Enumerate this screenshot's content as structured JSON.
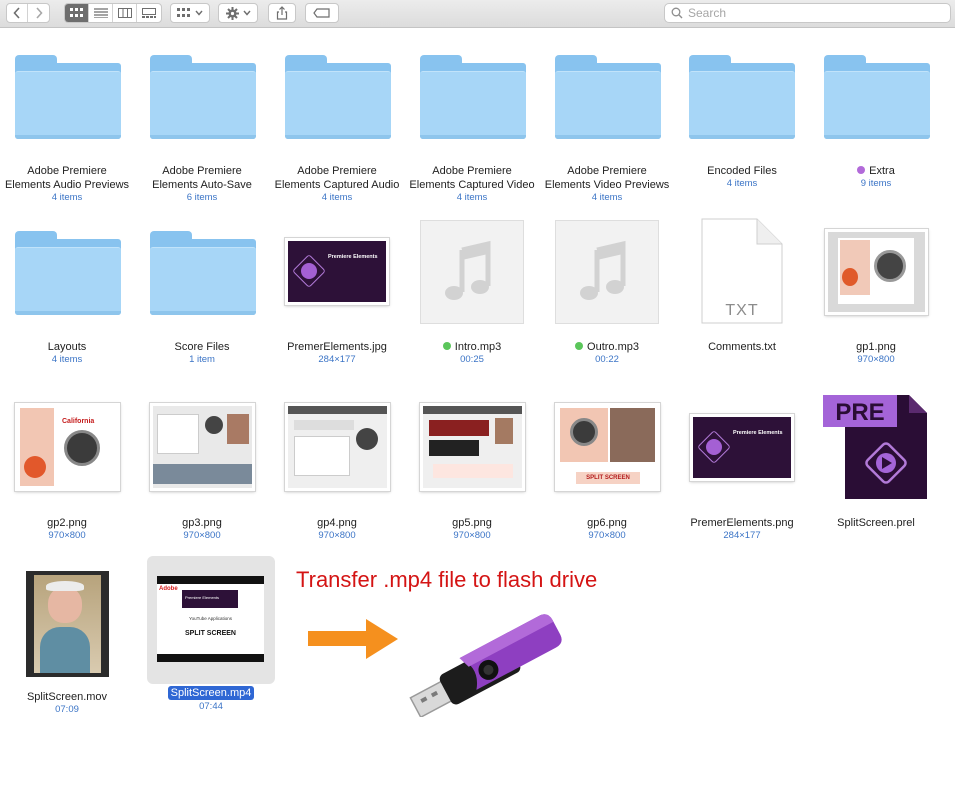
{
  "toolbar": {
    "back_icon": "chevron-left-icon",
    "forward_icon": "chevron-right-icon",
    "view_modes": [
      "icon-view",
      "list-view",
      "column-view",
      "gallery-view"
    ],
    "active_view": "icon-view",
    "search_placeholder": "Search"
  },
  "items": [
    {
      "name_line1": "Adobe Premiere",
      "name_line2": "Elements Audio Previews",
      "meta": "4 items",
      "kind": "folder"
    },
    {
      "name_line1": "Adobe Premiere",
      "name_line2": "Elements Auto-Save",
      "meta": "6 items",
      "kind": "folder"
    },
    {
      "name_line1": "Adobe Premiere",
      "name_line2": "Elements Captured Audio",
      "meta": "4 items",
      "kind": "folder"
    },
    {
      "name_line1": "Adobe Premiere",
      "name_line2": "Elements Captured Video",
      "meta": "4 items",
      "kind": "folder"
    },
    {
      "name_line1": "Adobe Premiere",
      "name_line2": "Elements Video Previews",
      "meta": "4 items",
      "kind": "folder"
    },
    {
      "name_line1": "Encoded Files",
      "meta": "4 items",
      "kind": "folder"
    },
    {
      "name_line1": "Extra",
      "meta": "9 items",
      "kind": "folder",
      "tag_color": "#b26ad9"
    },
    {
      "name_line1": "Layouts",
      "meta": "4 items",
      "kind": "folder"
    },
    {
      "name_line1": "Score Files",
      "meta": "1 item",
      "kind": "folder"
    },
    {
      "name_line1": "PremerElements.jpg",
      "meta": "284×177",
      "kind": "image"
    },
    {
      "name_line1": "Intro.mp3",
      "meta": "00:25",
      "kind": "audio",
      "tag_color": "#5bc65b"
    },
    {
      "name_line1": "Outro.mp3",
      "meta": "00:22",
      "kind": "audio",
      "tag_color": "#5bc65b"
    },
    {
      "name_line1": "Comments.txt",
      "kind": "text",
      "doc_label": "TXT"
    },
    {
      "name_line1": "gp1.png",
      "meta": "970×800",
      "kind": "image"
    },
    {
      "name_line1": "gp2.png",
      "meta": "970×800",
      "kind": "image"
    },
    {
      "name_line1": "gp3.png",
      "meta": "970×800",
      "kind": "image"
    },
    {
      "name_line1": "gp4.png",
      "meta": "970×800",
      "kind": "image"
    },
    {
      "name_line1": "gp5.png",
      "meta": "970×800",
      "kind": "image"
    },
    {
      "name_line1": "gp6.png",
      "meta": "970×800",
      "kind": "image"
    },
    {
      "name_line1": "PremerElements.png",
      "meta": "284×177",
      "kind": "image"
    },
    {
      "name_line1": "SplitScreen.prel",
      "kind": "project",
      "doc_label": "PRE"
    },
    {
      "name_line1": "SplitScreen.mov",
      "meta": "07:09",
      "kind": "video"
    },
    {
      "name_line1": "SplitScreen.mp4",
      "meta": "07:44",
      "kind": "video",
      "selected": true
    }
  ],
  "thumb_text": {
    "premiere_logo": "Premiere Elements",
    "california": "California",
    "split_screen": "SPLIT SCREEN",
    "youtube_apps": "YouTube Applications",
    "adobe": "Adobe"
  },
  "annotation": {
    "text": "Transfer .mp4 file to flash drive",
    "color": "#d41414",
    "arrow_color": "#f5901e",
    "drive_color": "#8e3fc1"
  },
  "colors": {
    "folder_front": "#a7d6f7",
    "folder_back": "#88c3ef",
    "selection": "#2f67d4",
    "meta_text": "#3b74c6"
  }
}
